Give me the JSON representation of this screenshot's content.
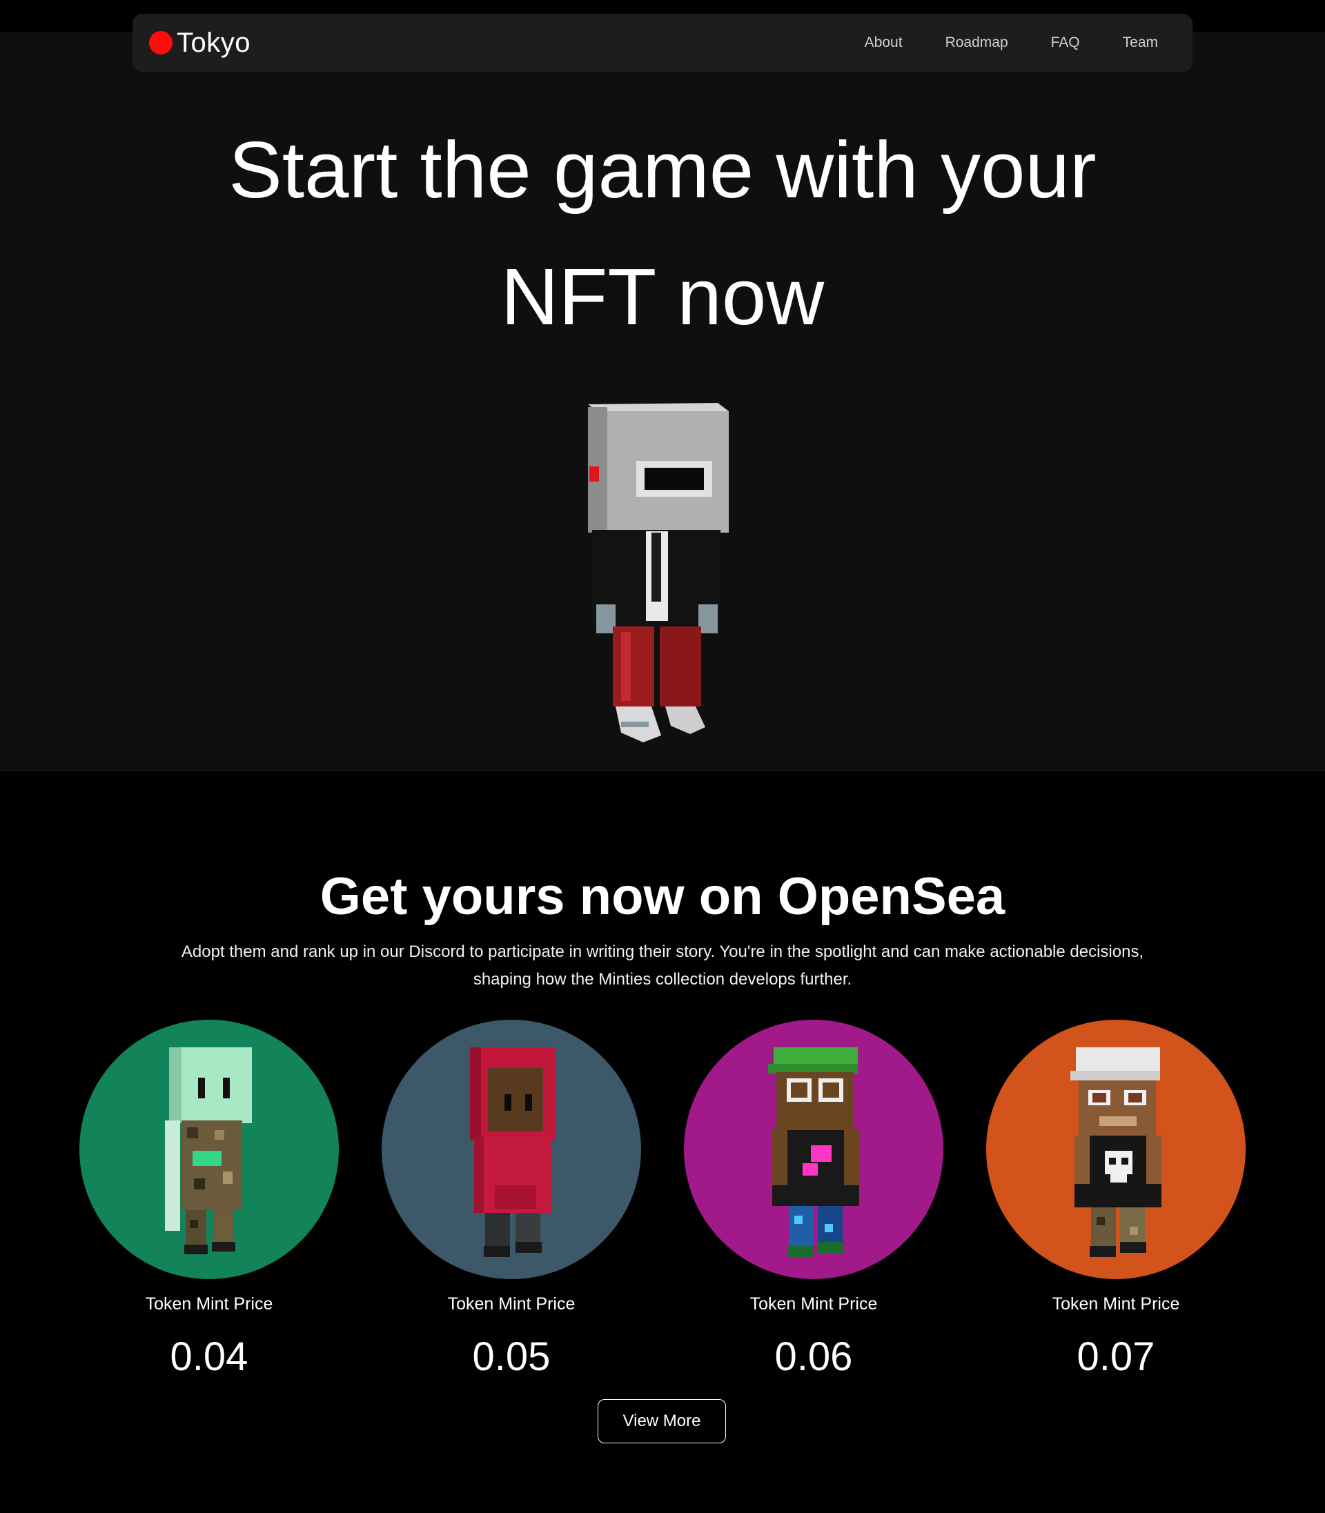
{
  "brand": {
    "name": "Tokyo",
    "dot_color": "#ff0d0d"
  },
  "nav": {
    "links": [
      "About",
      "Roadmap",
      "FAQ",
      "Team"
    ]
  },
  "hero": {
    "title": "Start the game with your NFT now",
    "figure_icon": "voxel-robot-helmet-character"
  },
  "opensea": {
    "title": "Get yours now on OpenSea",
    "description": "Adopt them and rank up in our Discord to participate in writing their story. You're in the spotlight and can make actionable decisions, shaping how the Minties collection develops further.",
    "cards": [
      {
        "label": "Token Mint Price",
        "price": "0.04",
        "bg": "#138359",
        "character_icon": "voxel-alien-camo-character"
      },
      {
        "label": "Token Mint Price",
        "price": "0.05",
        "bg": "#3d5868",
        "character_icon": "voxel-red-hoodie-character"
      },
      {
        "label": "Token Mint Price",
        "price": "0.06",
        "bg": "#a2198a",
        "character_icon": "voxel-green-cap-glasses-character"
      },
      {
        "label": "Token Mint Price",
        "price": "0.07",
        "bg": "#d2531c",
        "character_icon": "voxel-white-cap-skull-character"
      }
    ],
    "button_label": "View More"
  }
}
